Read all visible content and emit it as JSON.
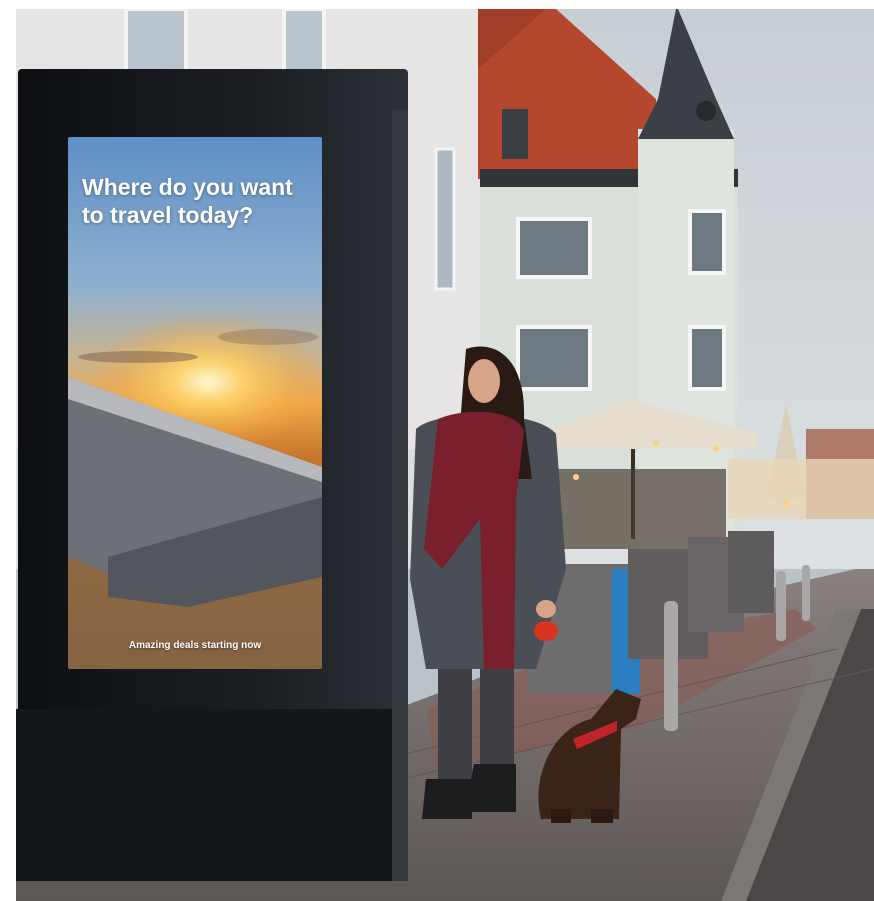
{
  "advertisement": {
    "headline": "Where do you want to travel today?",
    "tagline": "Amazing deals starting now"
  },
  "scene_elements": [
    "sky",
    "townhouse",
    "building-tower",
    "patio-umbrella",
    "digital-billboard",
    "woman",
    "dog",
    "bollards",
    "sidewalk",
    "cobblestone-road"
  ],
  "colors": {
    "billboard_frame": "#111417",
    "screen_sky_top": "#6f9fd0",
    "screen_sunset": "#f4b24a",
    "roof_tiles": "#b5472e",
    "building_facade": "#d9dfd9",
    "scarf": "#7a1f2c",
    "leash_handle": "#d8341f"
  }
}
